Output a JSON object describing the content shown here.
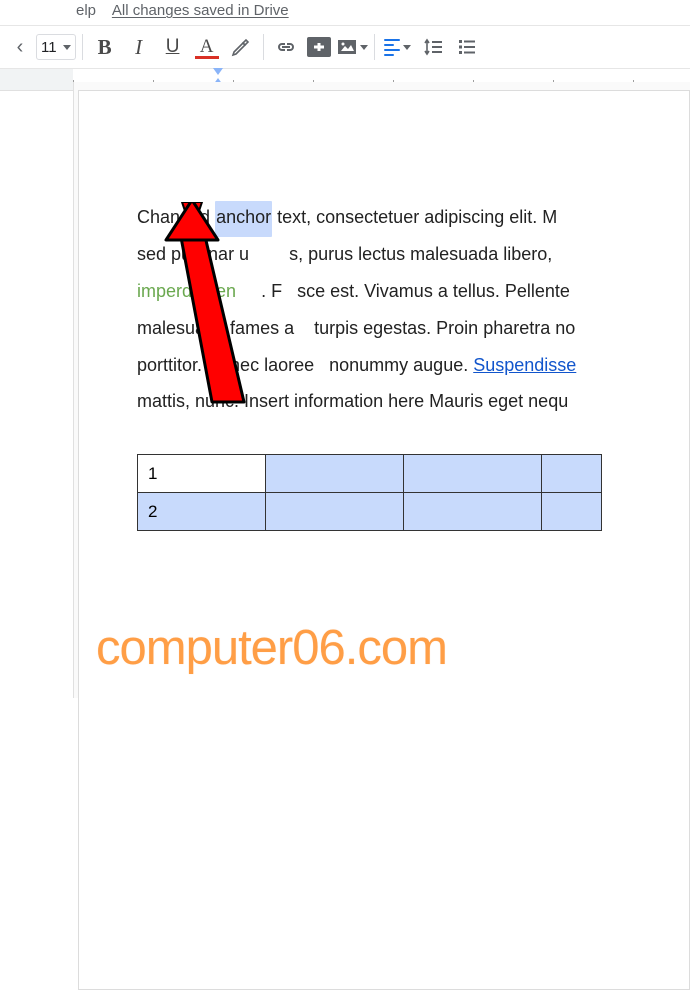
{
  "menu": {
    "help_partial": "elp"
  },
  "save_status": "All changes saved in Drive",
  "toolbar": {
    "font_size": "11",
    "bold": "B",
    "italic": "I",
    "underline": "U",
    "text_color": "A"
  },
  "doc": {
    "line1_pre": "Changed ",
    "line1_sel": "anchor",
    "line1_post": " text, consectetuer adipiscing elit. M",
    "line2_pre": "sed pulvinar u",
    "line2_post": "s, purus lectus malesuada libero, ",
    "line3_green": "imperdiet en",
    "line3_mid": ". F",
    "line3_post": "sce est. Vivamus a tellus. Pellente",
    "line4_pre": "malesuada fames a",
    "line4_post": "turpis egestas. Proin pharetra no",
    "line5_pre": "porttitor. Donec laoree",
    "line5_mid": "nonummy augue. ",
    "line5_link": "Suspendisse",
    "line6": "mattis, nunc. Insert information here Mauris eget nequ"
  },
  "table": {
    "r1c1": "1",
    "r2c1": "2"
  },
  "watermark": "computer06.com"
}
